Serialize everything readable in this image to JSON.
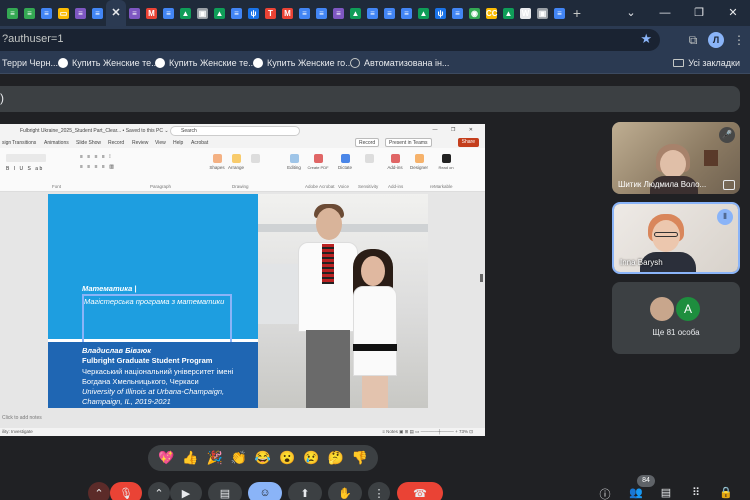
{
  "browser": {
    "tab_icons": [
      {
        "icon": "sheets-icon",
        "color": "#34a853",
        "glyph": "≡"
      },
      {
        "icon": "sheets-icon",
        "color": "#34a853",
        "glyph": "≡"
      },
      {
        "icon": "docs-icon",
        "color": "#4285f4",
        "glyph": "≡"
      },
      {
        "icon": "slides-icon",
        "color": "#fbbc04",
        "glyph": "▭"
      },
      {
        "icon": "forms-icon",
        "color": "#7e57c2",
        "glyph": "≡"
      },
      {
        "icon": "docs-icon",
        "color": "#4285f4",
        "glyph": "≡"
      },
      {
        "icon": "close-icon",
        "color": "transparent",
        "glyph": "✕",
        "active": true
      },
      {
        "icon": "forms-icon",
        "color": "#7e57c2",
        "glyph": "≡"
      },
      {
        "icon": "gmail-icon",
        "color": "#ea4335",
        "glyph": "M"
      },
      {
        "icon": "docs-icon",
        "color": "#4285f4",
        "glyph": "≡"
      },
      {
        "icon": "drive-icon",
        "color": "#0f9d58",
        "glyph": "▲"
      },
      {
        "icon": "photo-icon",
        "color": "#9aa0a6",
        "glyph": "▣"
      },
      {
        "icon": "drive-icon",
        "color": "#0f9d58",
        "glyph": "▲"
      },
      {
        "icon": "docs-icon",
        "color": "#4285f4",
        "glyph": "≡"
      },
      {
        "icon": "trident-icon",
        "color": "#1a73e8",
        "glyph": "ψ"
      },
      {
        "icon": "info-icon",
        "color": "#ea4335",
        "glyph": "T"
      },
      {
        "icon": "gmail-icon",
        "color": "#ea4335",
        "glyph": "M"
      },
      {
        "icon": "docs-icon",
        "color": "#4285f4",
        "glyph": "≡"
      },
      {
        "icon": "docs-icon",
        "color": "#4285f4",
        "glyph": "≡"
      },
      {
        "icon": "forms-icon",
        "color": "#7e57c2",
        "glyph": "≡"
      },
      {
        "icon": "drive-icon",
        "color": "#0f9d58",
        "glyph": "▲"
      },
      {
        "icon": "docs-icon",
        "color": "#4285f4",
        "glyph": "≡"
      },
      {
        "icon": "docs-icon",
        "color": "#4285f4",
        "glyph": "≡"
      },
      {
        "icon": "docs-icon",
        "color": "#4285f4",
        "glyph": "≡"
      },
      {
        "icon": "drive-icon",
        "color": "#0f9d58",
        "glyph": "▲"
      },
      {
        "icon": "trident-icon",
        "color": "#1a73e8",
        "glyph": "ψ"
      },
      {
        "icon": "docs-icon",
        "color": "#4285f4",
        "glyph": "≡"
      },
      {
        "icon": "chrome-icon",
        "color": "#34a853",
        "glyph": "◉"
      },
      {
        "icon": "cc-icon",
        "color": "#fbbc04",
        "glyph": "CC"
      },
      {
        "icon": "drive-icon",
        "color": "#0f9d58",
        "glyph": "▲"
      },
      {
        "icon": "wikipedia-icon",
        "color": "#e8eaed",
        "glyph": "W"
      },
      {
        "icon": "photo-icon",
        "color": "#9aa0a6",
        "glyph": "▣"
      },
      {
        "icon": "docs-icon",
        "color": "#4285f4",
        "glyph": "≡"
      }
    ],
    "new_tab_glyph": "+",
    "window_controls": [
      "⌄",
      "—",
      "❐",
      "✕"
    ],
    "url": "?authuser=1",
    "profile_initial": "Л",
    "bookmarks": [
      "Терри Черн...",
      "Купить Женские те...",
      "Купить Женские те...",
      "Купить Женские го...",
      "Автоматизована ін..."
    ],
    "all_bookmarks": "Усі закладки"
  },
  "meet": {
    "presentation_label": ")",
    "participants": [
      {
        "name": "Шитик Людмила Воло...",
        "indicator_icon": "mic-off-icon",
        "indicator": "🎤"
      },
      {
        "name": "Inna Barysh",
        "indicator_icon": "speaking-icon",
        "indicator": "⦀"
      },
      {
        "name": "Ще 81 особа",
        "avatar_letter": "A"
      }
    ],
    "reactions": [
      "💖",
      "👍",
      "🎉",
      "👏",
      "😂",
      "😮",
      "😢",
      "🤔",
      "👎"
    ],
    "participant_count": "84",
    "controls": {
      "more_glyph": "⋮",
      "end_call_icon": "phone-hangup-icon"
    },
    "accent": "#8ab4f8",
    "end_call_color": "#ea4335"
  },
  "powerpoint": {
    "title": "Fulbright Ukraine_2025_Student Part_Clear... • Saved to this PC ⌄",
    "search": "Search",
    "tabs": [
      "sign",
      "Transitions",
      "Animations",
      "Slide Show",
      "Record",
      "Review",
      "View",
      "Help",
      "Acrobat"
    ],
    "record_button": "Record",
    "present_teams": "Present in Teams",
    "share_button": "Share",
    "ribbon_buttons": [
      "Shapes",
      "Arrange",
      "Quick Styles",
      "Editing",
      "Create a PDF and Share link",
      "Dictate",
      "Sensitivity",
      "Add-ins",
      "Designer",
      "Read on reMarkable"
    ],
    "ribbon_groups": [
      "Font",
      "Paragraph",
      "Drawing",
      "Adobe Acrobat",
      "Voice",
      "Sensitivity",
      "Add-ins",
      "reMarkable"
    ],
    "slide": {
      "subject": "Математика |",
      "program": "Магістерська програма з математики",
      "person": "Владислав Бівзюк",
      "fulbright": "Fulbright Graduate Student Program",
      "home_uni": "Черкаський національний університет імені Богдана Хмельницького, Черкаси",
      "host_uni": "University of Illinois at Urbana-Champaign, Champaign, IL, 2019-2021"
    },
    "notes_placeholder": "Click to add notes",
    "status_left": "ility: Investigate",
    "status_right": "≡ Notes   ▣   ⊞   ▤   ▭   —────┼────  + 73%  ⊡"
  }
}
